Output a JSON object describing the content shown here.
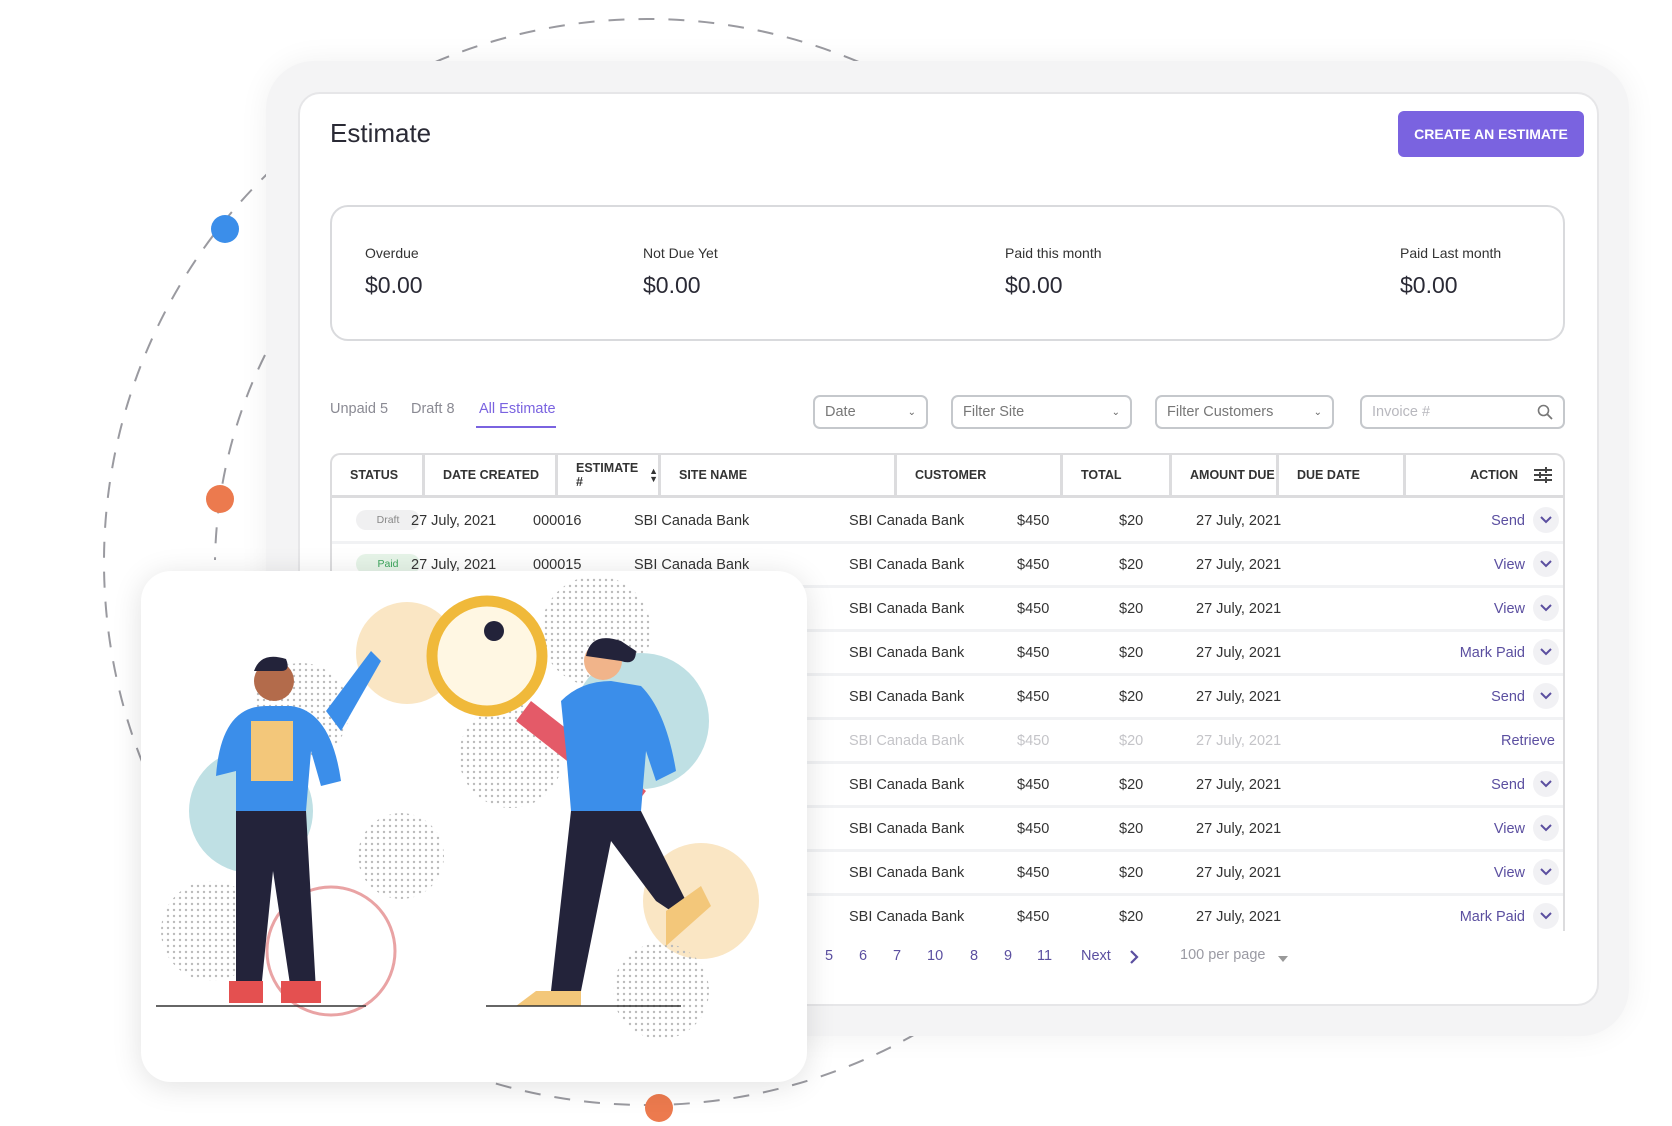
{
  "page": {
    "title": "Estimate",
    "create_button": "CREATE AN ESTIMATE"
  },
  "summary": [
    {
      "label": "Overdue",
      "value": "$0.00"
    },
    {
      "label": "Not Due Yet",
      "value": "$0.00"
    },
    {
      "label": "Paid this month",
      "value": "$0.00"
    },
    {
      "label": "Paid Last month",
      "value": "$0.00"
    }
  ],
  "tabs": [
    {
      "label": "Unpaid 5"
    },
    {
      "label": "Draft 8"
    },
    {
      "label": "All Estimate",
      "active": true
    }
  ],
  "filters": {
    "date": "Date",
    "site": "Filter Site",
    "customers": "Filter Customers",
    "invoice_placeholder": "Invoice #"
  },
  "table": {
    "headers": [
      "STATUS",
      "DATE CREATED",
      "ESTIMATE #",
      "SITE NAME",
      "CUSTOMER",
      "TOTAL",
      "AMOUNT DUE",
      "DUE DATE",
      "ACTION"
    ],
    "rows": [
      {
        "status": "Draft",
        "date_created": "27 July, 2021",
        "estimate": "000016",
        "site": "SBI Canada Bank",
        "customer": "SBI Canada Bank",
        "total": "$450",
        "amount_due": "$20",
        "due_date": "27 July, 2021",
        "action": "Send"
      },
      {
        "status": "Paid",
        "date_created": "27 July, 2021",
        "estimate": "000015",
        "site": "SBI Canada Bank",
        "customer": "SBI Canada Bank",
        "total": "$450",
        "amount_due": "$20",
        "due_date": "27 July, 2021",
        "action": "View"
      },
      {
        "customer": "SBI Canada Bank",
        "total": "$450",
        "amount_due": "$20",
        "due_date": "27 July, 2021",
        "action": "View"
      },
      {
        "customer": "SBI Canada Bank",
        "total": "$450",
        "amount_due": "$20",
        "due_date": "27 July, 2021",
        "action": "Mark Paid"
      },
      {
        "customer": "SBI Canada Bank",
        "total": "$450",
        "amount_due": "$20",
        "due_date": "27 July, 2021",
        "action": "Send"
      },
      {
        "customer": "SBI Canada Bank",
        "total": "$450",
        "amount_due": "$20",
        "due_date": "27 July, 2021",
        "action": "Retrieve",
        "faded": true
      },
      {
        "customer": "SBI Canada Bank",
        "total": "$450",
        "amount_due": "$20",
        "due_date": "27 July, 2021",
        "action": "Send"
      },
      {
        "customer": "SBI Canada Bank",
        "total": "$450",
        "amount_due": "$20",
        "due_date": "27 July, 2021",
        "action": "View"
      },
      {
        "customer": "SBI Canada Bank",
        "total": "$450",
        "amount_due": "$20",
        "due_date": "27 July, 2021",
        "action": "View"
      },
      {
        "customer": "SBI Canada Bank",
        "total": "$450",
        "amount_due": "$20",
        "due_date": "27 July, 2021",
        "action": "Mark Paid"
      }
    ]
  },
  "pagination": {
    "pages": [
      "5",
      "6",
      "7",
      "10",
      "8",
      "9",
      "11"
    ],
    "next": "Next",
    "per_page": "100 per page"
  },
  "colors": {
    "accent": "#7a63e0",
    "action_text": "#5b4fa0",
    "paid_green": "#3ca55c",
    "dot_blue": "#3b8eea",
    "dot_orange": "#ec7a4e"
  },
  "icons": {
    "sort": "sort-arrows-icon",
    "settings": "sliders-icon",
    "search": "search-icon",
    "row_menu": "chevron-down-icon"
  }
}
